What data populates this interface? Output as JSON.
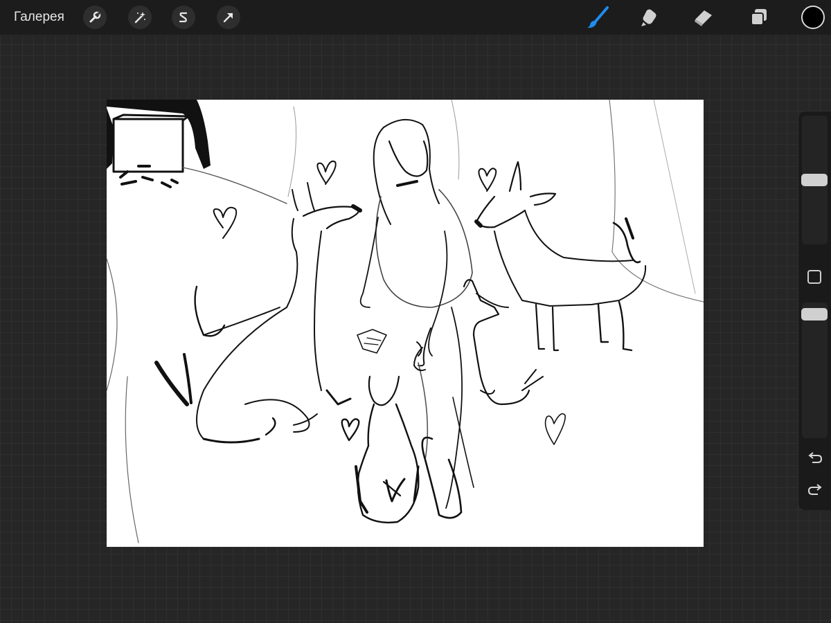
{
  "topbar": {
    "gallery_label": "Галерея",
    "left_tools": [
      "wrench-icon",
      "magic-wand-icon",
      "selection-s-icon",
      "transform-arrow-icon"
    ],
    "right_tools": [
      "brush-icon",
      "smudge-icon",
      "eraser-icon",
      "layers-icon"
    ],
    "active_tool": "brush",
    "current_color": "#000000",
    "accent_color": "#1e8cf0"
  },
  "sidebar": {
    "brush_size_level": 0.5,
    "opacity_level": 0.1,
    "buttons": [
      "modify-square-icon",
      "undo-icon",
      "redo-icon"
    ]
  },
  "canvas": {
    "background": "#ffffff",
    "content": "sketch-artwork"
  }
}
